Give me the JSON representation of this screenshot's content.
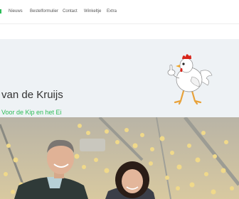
{
  "nav": {
    "items": [
      {
        "label": "Nieuws"
      },
      {
        "label": "Bestelformulier"
      },
      {
        "label": "Contact"
      },
      {
        "label": "Winkeltje"
      },
      {
        "label": "Extra"
      }
    ]
  },
  "hero": {
    "title": "van de Kruijs",
    "tagline": "Voor de Kip en het Ei"
  },
  "colors": {
    "accent": "#2ebd59",
    "hero_bg": "#eef2f5"
  },
  "icons": {
    "mascot": "chicken-thumbs-up-icon"
  }
}
